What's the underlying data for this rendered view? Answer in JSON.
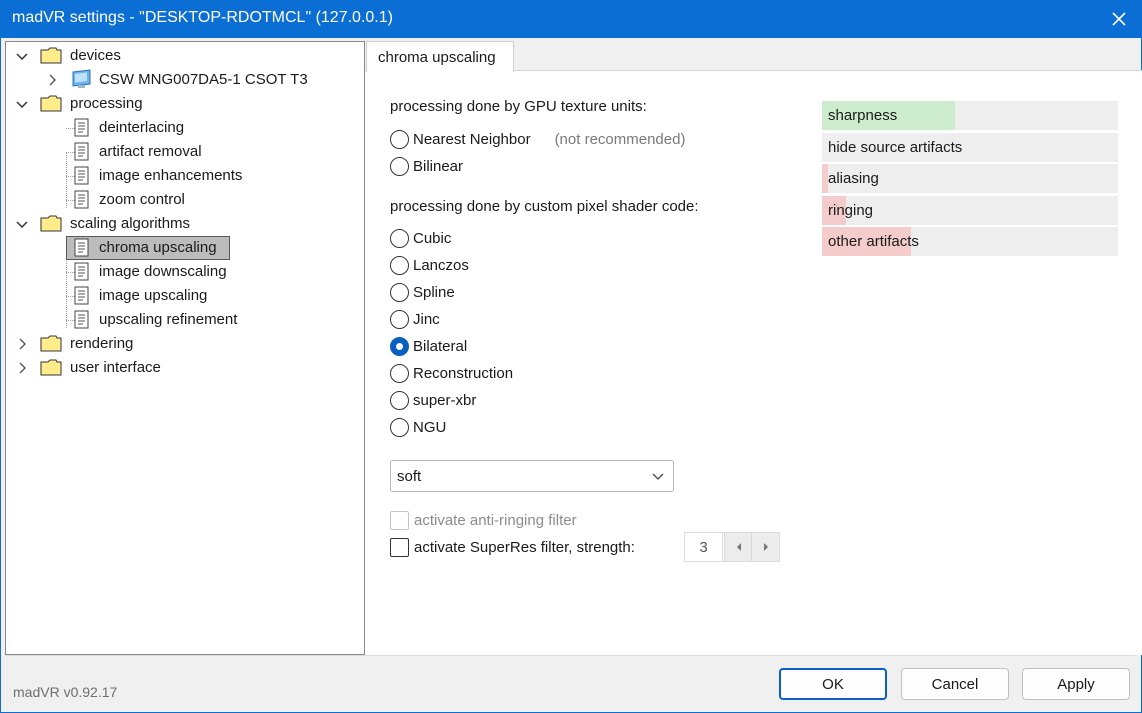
{
  "window": {
    "title": "madVR settings - \"DESKTOP-RDOTMCL\" (127.0.0.1)"
  },
  "tree": {
    "devices": "devices",
    "device_item": "CSW MNG007DA5-1 CSOT T3",
    "processing": "processing",
    "processing_items": [
      "deinterlacing",
      "artifact removal",
      "image enhancements",
      "zoom control"
    ],
    "scaling": "scaling algorithms",
    "scaling_items": [
      "chroma upscaling",
      "image downscaling",
      "image upscaling",
      "upscaling refinement"
    ],
    "rendering": "rendering",
    "user_interface": "user interface",
    "selected": "chroma upscaling"
  },
  "tab": {
    "label": "chroma upscaling"
  },
  "gpu_section": {
    "heading": "processing done by GPU texture units:",
    "options": [
      "Nearest Neighbor",
      "Bilinear"
    ],
    "nearest_note": "(not recommended)"
  },
  "shader_section": {
    "heading": "processing done by custom pixel shader code:",
    "options": [
      "Cubic",
      "Lanczos",
      "Spline",
      "Jinc",
      "Bilateral",
      "Reconstruction",
      "super-xbr",
      "NGU"
    ],
    "selected": "Bilateral"
  },
  "quality_select": {
    "value": "soft"
  },
  "checkboxes": {
    "anti_ringing": "activate anti-ringing filter",
    "superres": "activate SuperRes filter, strength:",
    "superres_strength": "3"
  },
  "ratings": [
    {
      "label": "sharpness",
      "level": 0.45,
      "color": "#cdeccd"
    },
    {
      "label": "hide source artifacts",
      "level": 0,
      "color": "#cdeccd"
    },
    {
      "label": "aliasing",
      "level": 0.02,
      "color": "#f5cccc"
    },
    {
      "label": "ringing",
      "level": 0.08,
      "color": "#f5cccc"
    },
    {
      "label": "other artifacts",
      "level": 0.3,
      "color": "#f5cccc"
    }
  ],
  "footer": {
    "version": "madVR v0.92.17",
    "ok": "OK",
    "cancel": "Cancel",
    "apply": "Apply"
  },
  "colors": {
    "titlebar": "#0a6ed4",
    "selected_radio": "#0a5fc4"
  }
}
